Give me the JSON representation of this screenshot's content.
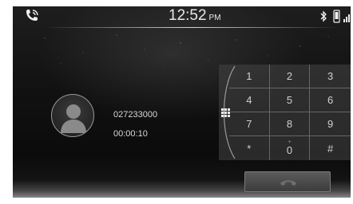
{
  "status_bar": {
    "time": "12:52",
    "ampm": "PM",
    "icons": [
      "call-active-icon",
      "bluetooth-icon",
      "phone-icon",
      "signal-icon"
    ]
  },
  "call": {
    "number": "027233000",
    "duration": "00:00:10",
    "avatar_icon": "person-icon"
  },
  "keypad": {
    "toggle_icon": "keypad-grid-icon",
    "keys": [
      {
        "label": "1",
        "sub": ""
      },
      {
        "label": "2",
        "sub": ""
      },
      {
        "label": "3",
        "sub": ""
      },
      {
        "label": "4",
        "sub": ""
      },
      {
        "label": "5",
        "sub": ""
      },
      {
        "label": "6",
        "sub": ""
      },
      {
        "label": "7",
        "sub": ""
      },
      {
        "label": "8",
        "sub": ""
      },
      {
        "label": "9",
        "sub": ""
      },
      {
        "label": "*",
        "sub": ""
      },
      {
        "label": "0",
        "sub": "+"
      },
      {
        "label": "#",
        "sub": ""
      }
    ]
  },
  "end_call": {
    "icon": "hang-up-icon",
    "color": "#6e6e6e"
  }
}
